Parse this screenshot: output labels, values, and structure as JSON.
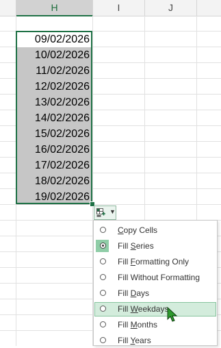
{
  "columns": [
    "H",
    "I",
    "J"
  ],
  "cells": [
    "09/02/2026",
    "10/02/2026",
    "11/02/2026",
    "12/02/2026",
    "13/02/2026",
    "14/02/2026",
    "15/02/2026",
    "16/02/2026",
    "17/02/2026",
    "18/02/2026",
    "19/02/2026"
  ],
  "autofill_options": {
    "icon": "autofill-options-icon",
    "dropdown_icon": "chevron-down-icon",
    "items": [
      {
        "label": "Copy Cells",
        "selected": false
      },
      {
        "label": "Fill Series",
        "selected": true
      },
      {
        "label": "Fill Formatting Only",
        "selected": false
      },
      {
        "label": "Fill Without Formatting",
        "selected": false
      },
      {
        "label": "Fill Days",
        "selected": false
      },
      {
        "label": "Fill Weekdays",
        "selected": false,
        "hovered": true
      },
      {
        "label": "Fill Months",
        "selected": false
      },
      {
        "label": "Fill Years",
        "selected": false
      }
    ]
  },
  "colors": {
    "accent": "#1e7145",
    "selection_fill": "#c6c6c6",
    "hover_fill": "#d3ecdc",
    "cursor": "#2e9a2e"
  }
}
